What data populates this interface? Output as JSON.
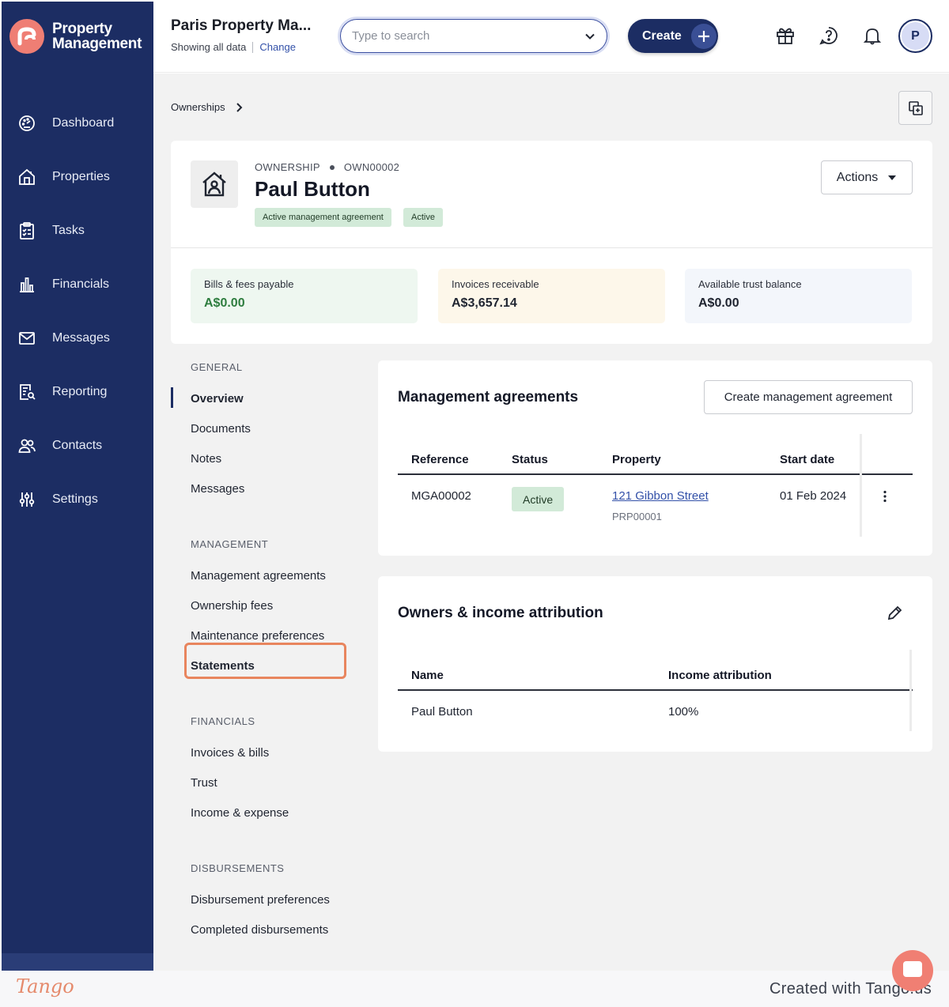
{
  "brand": {
    "name_line1": "Property",
    "name_line2": "Management",
    "logo_color": "#ef7e74"
  },
  "sidebar": {
    "items": [
      {
        "label": "Dashboard",
        "icon": "dashboard-gauge-icon"
      },
      {
        "label": "Properties",
        "icon": "house-icon"
      },
      {
        "label": "Tasks",
        "icon": "clipboard-checklist-icon"
      },
      {
        "label": "Financials",
        "icon": "bar-chart-icon"
      },
      {
        "label": "Messages",
        "icon": "envelope-icon"
      },
      {
        "label": "Reporting",
        "icon": "report-search-icon"
      },
      {
        "label": "Contacts",
        "icon": "people-icon"
      },
      {
        "label": "Settings",
        "icon": "sliders-icon"
      }
    ]
  },
  "topbar": {
    "org_title": "Paris Property Ma...",
    "showing": "Showing all data",
    "change": "Change",
    "search_placeholder": "Type to search",
    "create_label": "Create",
    "avatar_initial": "P"
  },
  "breadcrumb": {
    "item": "Ownerships"
  },
  "ownership": {
    "kicker": "OWNERSHIP",
    "code": "OWN00002",
    "name": "Paul Button",
    "badges": [
      "Active management agreement",
      "Active"
    ],
    "actions_label": "Actions"
  },
  "stats": [
    {
      "label": "Bills & fees payable",
      "value": "A$0.00",
      "bg": "#eef7f0",
      "color": "#2e7d3f"
    },
    {
      "label": "Invoices receivable",
      "value": "A$3,657.14",
      "bg": "#fdf7ea",
      "color": "#1f2430"
    },
    {
      "label": "Available trust balance",
      "value": "A$0.00",
      "bg": "#f3f6fb",
      "color": "#1f2430"
    }
  ],
  "subnav": {
    "general": {
      "title": "GENERAL",
      "items": [
        "Overview",
        "Documents",
        "Notes",
        "Messages"
      ]
    },
    "management": {
      "title": "MANAGEMENT",
      "items": [
        "Management agreements",
        "Ownership fees",
        "Maintenance preferences",
        "Statements"
      ]
    },
    "financials": {
      "title": "FINANCIALS",
      "items": [
        "Invoices & bills",
        "Trust",
        "Income & expense"
      ]
    },
    "disbursements": {
      "title": "DISBURSEMENTS",
      "items": [
        "Disbursement preferences",
        "Completed disbursements"
      ]
    }
  },
  "management_agreements": {
    "title": "Management agreements",
    "create_label": "Create management agreement",
    "columns": [
      "Reference",
      "Status",
      "Property",
      "Start date"
    ],
    "rows": [
      {
        "reference": "MGA00002",
        "status": "Active",
        "property": "121 Gibbon Street",
        "property_code": "PRP00001",
        "start_date": "01 Feb 2024"
      }
    ]
  },
  "owners": {
    "title": "Owners & income attribution",
    "columns": [
      "Name",
      "Income attribution"
    ],
    "rows": [
      {
        "name": "Paul Button",
        "attribution": "100%"
      }
    ]
  },
  "footer": {
    "logo": "Tango",
    "made": "Created with Tango.us"
  }
}
